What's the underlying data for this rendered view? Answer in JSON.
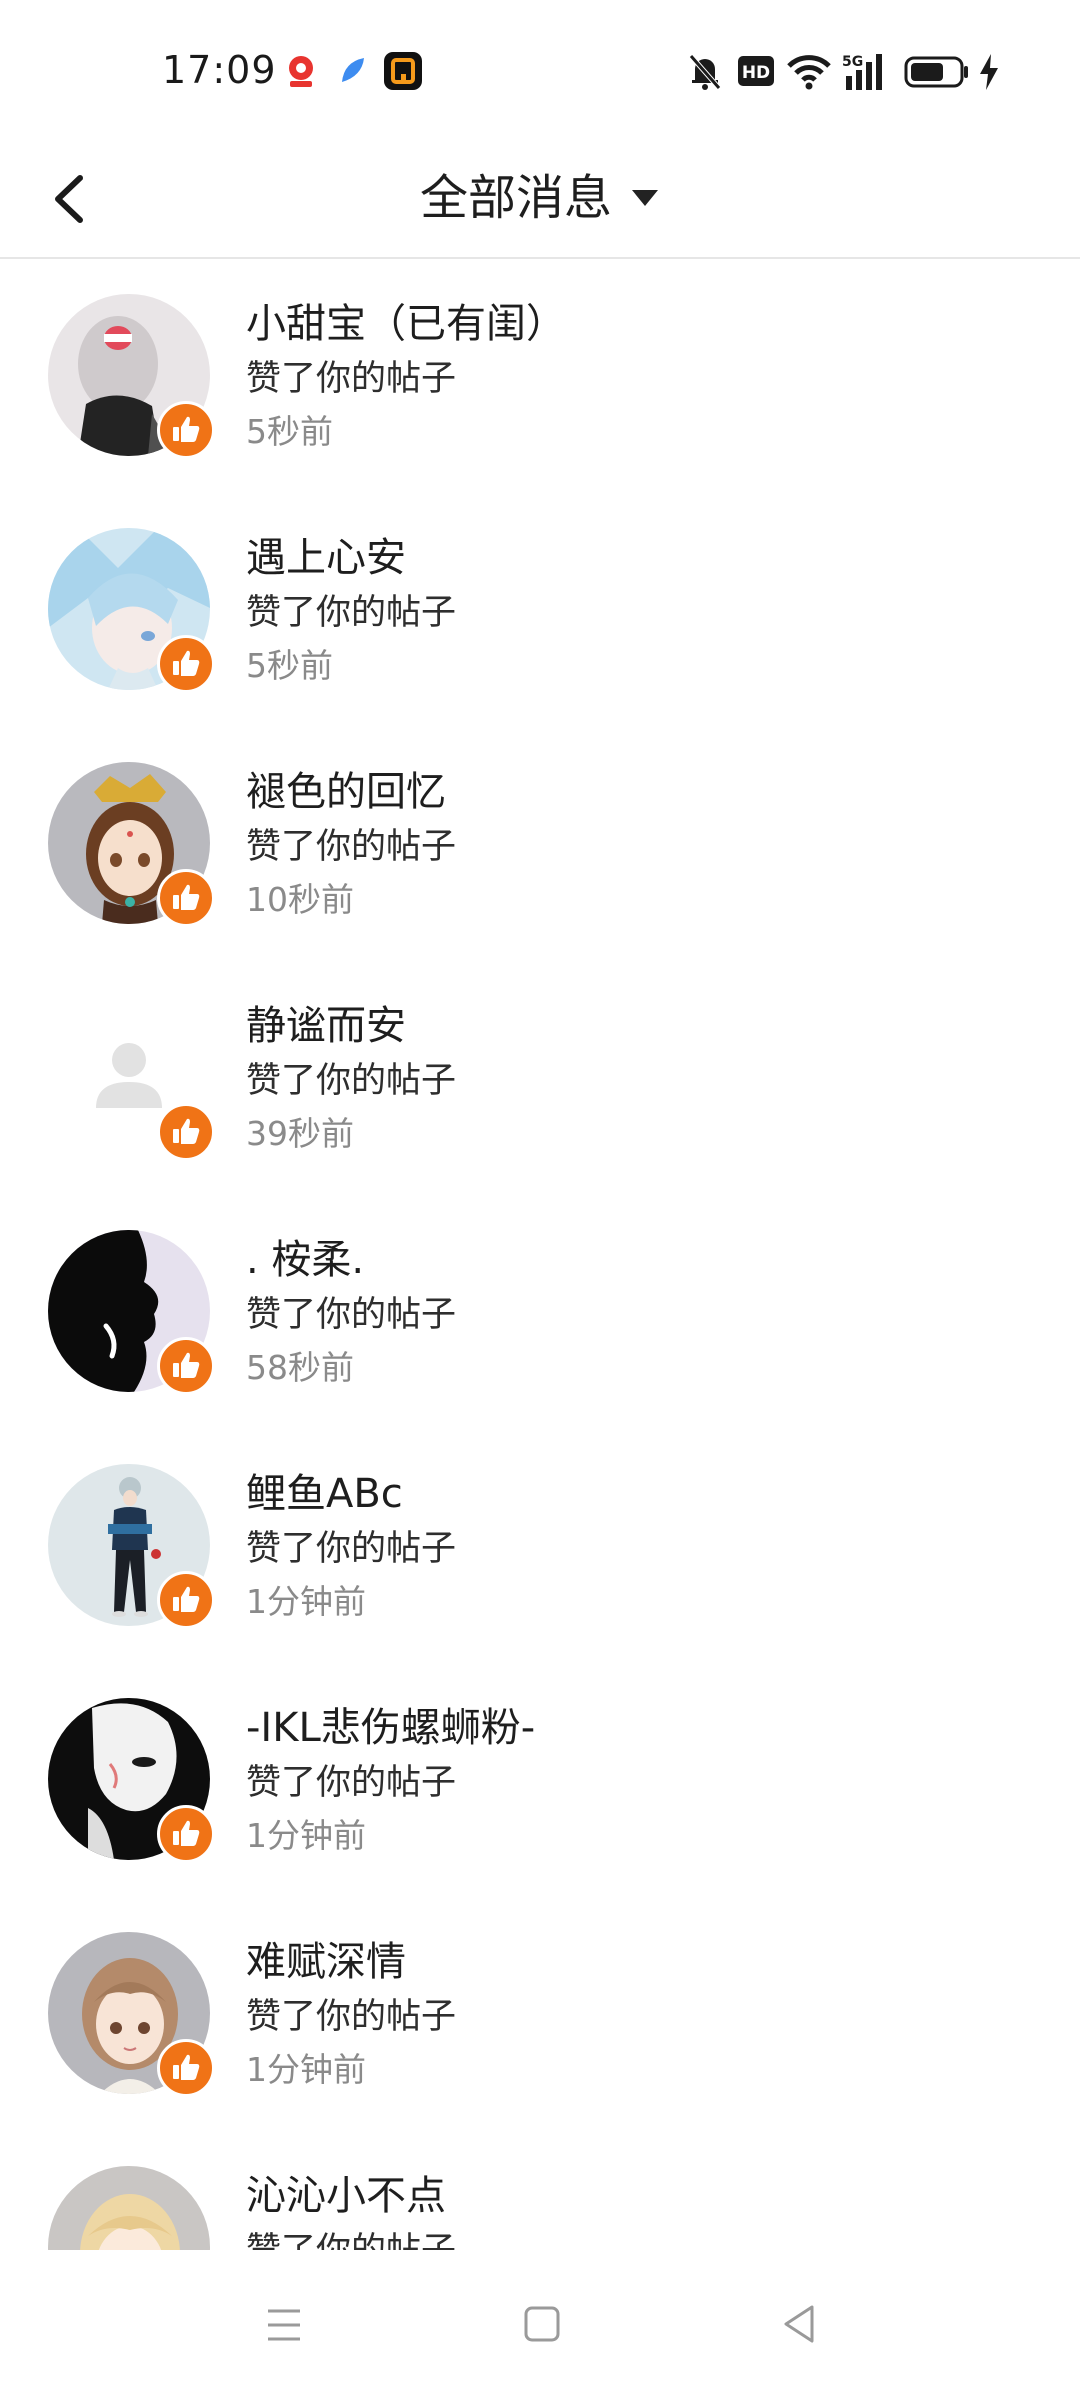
{
  "status_bar": {
    "time": "17:09",
    "notification_icons": [
      "map-app-icon",
      "feather-app-icon",
      "orange-box-app-icon"
    ],
    "system_icons": [
      "mute-bell-icon",
      "hd-icon",
      "wifi-icon",
      "5g-signal-icon",
      "battery-icon",
      "charging-icon"
    ],
    "hd_label": "HD",
    "network_label": "5G"
  },
  "header": {
    "title": "全部消息",
    "back_icon": "chevron-left-icon",
    "dropdown_icon": "caret-down-icon"
  },
  "badge": {
    "icon": "thumbs-up-icon",
    "color": "#f07316"
  },
  "messages": [
    {
      "name": "小甜宝（已有闺）",
      "action": "赞了你的帖子",
      "time": "5秒前",
      "avatar": "girl-mask-avatar"
    },
    {
      "name": "遇上心安",
      "action": "赞了你的帖子",
      "time": "5秒前",
      "avatar": "ice-anime-avatar"
    },
    {
      "name": "褪色的回忆",
      "action": "赞了你的帖子",
      "time": "10秒前",
      "avatar": "anime-girl-crown-avatar"
    },
    {
      "name": "静谧而安",
      "action": "赞了你的帖子",
      "time": "39秒前",
      "avatar": "default-person-avatar"
    },
    {
      "name": ". 桉柔.",
      "action": "赞了你的帖子",
      "time": "58秒前",
      "avatar": "silhouette-avatar"
    },
    {
      "name": "鲤鱼ABc",
      "action": "赞了你的帖子",
      "time": "1分钟前",
      "avatar": "standing-figure-avatar"
    },
    {
      "name": "-IKL悲伤螺蛳粉-",
      "action": "赞了你的帖子",
      "time": "1分钟前",
      "avatar": "mask-face-avatar"
    },
    {
      "name": "难赋深情",
      "action": "赞了你的帖子",
      "time": "1分钟前",
      "avatar": "brown-hair-girl-avatar"
    },
    {
      "name": "沁沁小不点",
      "action": "赞了你的帖子",
      "time": "",
      "avatar": "blonde-girl-avatar"
    }
  ],
  "nav_bar": {
    "buttons": [
      "menu-icon",
      "home-square-icon",
      "back-triangle-icon"
    ]
  }
}
